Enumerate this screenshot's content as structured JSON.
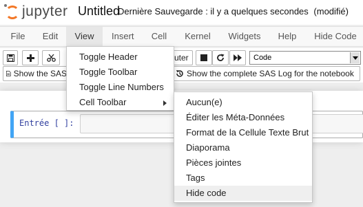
{
  "header": {
    "logo_text": "jupyter",
    "notebook_title": "Untitled",
    "save_status": "Dernière Sauvegarde : il y a quelques secondes",
    "modified": "(modifié)"
  },
  "menubar": {
    "items": [
      "File",
      "Edit",
      "View",
      "Insert",
      "Cell",
      "Kernel",
      "Widgets",
      "Help",
      "Hide Code"
    ],
    "active": "View"
  },
  "toolbar": {
    "buttons": [
      "save-icon",
      "plus-icon",
      "scissors-icon",
      "stop-icon",
      "restart-icon",
      "fast-forward-icon"
    ],
    "run_label_fragment": "cuter",
    "cell_type_value": "Code",
    "sas_log_short": "Show the SAS",
    "sas_log_full": "Show the complete SAS Log for the notebook"
  },
  "cell": {
    "prompt": "Entrée [ ]:"
  },
  "view_menu": {
    "items": [
      "Toggle Header",
      "Toggle Toolbar",
      "Toggle Line Numbers",
      "Cell Toolbar"
    ]
  },
  "cell_toolbar_submenu": {
    "items": [
      "Aucun(e)",
      "Éditer les Méta-Données",
      "Format de la Cellule Texte Brut",
      "Diaporama",
      "Pièces jointes",
      "Tags",
      "Hide code"
    ],
    "highlighted": "Hide code"
  },
  "colors": {
    "jupyter_orange": "#f37726",
    "selected_cell_border": "#42a5f5",
    "prompt_blue": "#303f9f"
  }
}
